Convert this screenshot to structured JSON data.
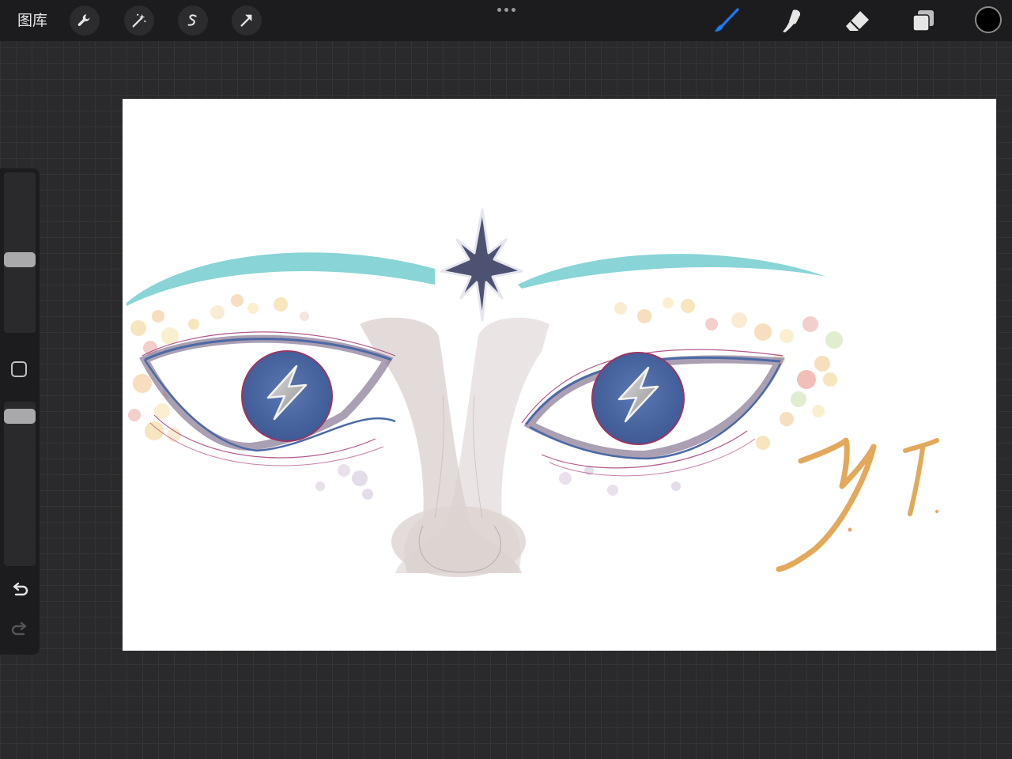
{
  "topbar": {
    "gallery_label": "图库",
    "left_tools": [
      "wrench-icon",
      "magic-wand-icon",
      "selection-icon",
      "transform-arrow-icon"
    ],
    "right_tools": [
      "brush-icon",
      "smudge-icon",
      "eraser-icon",
      "layers-icon"
    ],
    "active_tool": "brush-icon",
    "current_color": "#000000",
    "accent_color": "#1a7cf5"
  },
  "sidebar": {
    "brush_size_level": 0.45,
    "opacity_level": 0.95,
    "buttons": [
      "modify-button",
      "undo-icon",
      "redo-icon"
    ]
  },
  "artwork": {
    "signature_color": "#e3a85a",
    "eyebrow_color": "#7ccfd2",
    "iris_color": "#4b6aa5",
    "star_color": "#4d5273"
  }
}
